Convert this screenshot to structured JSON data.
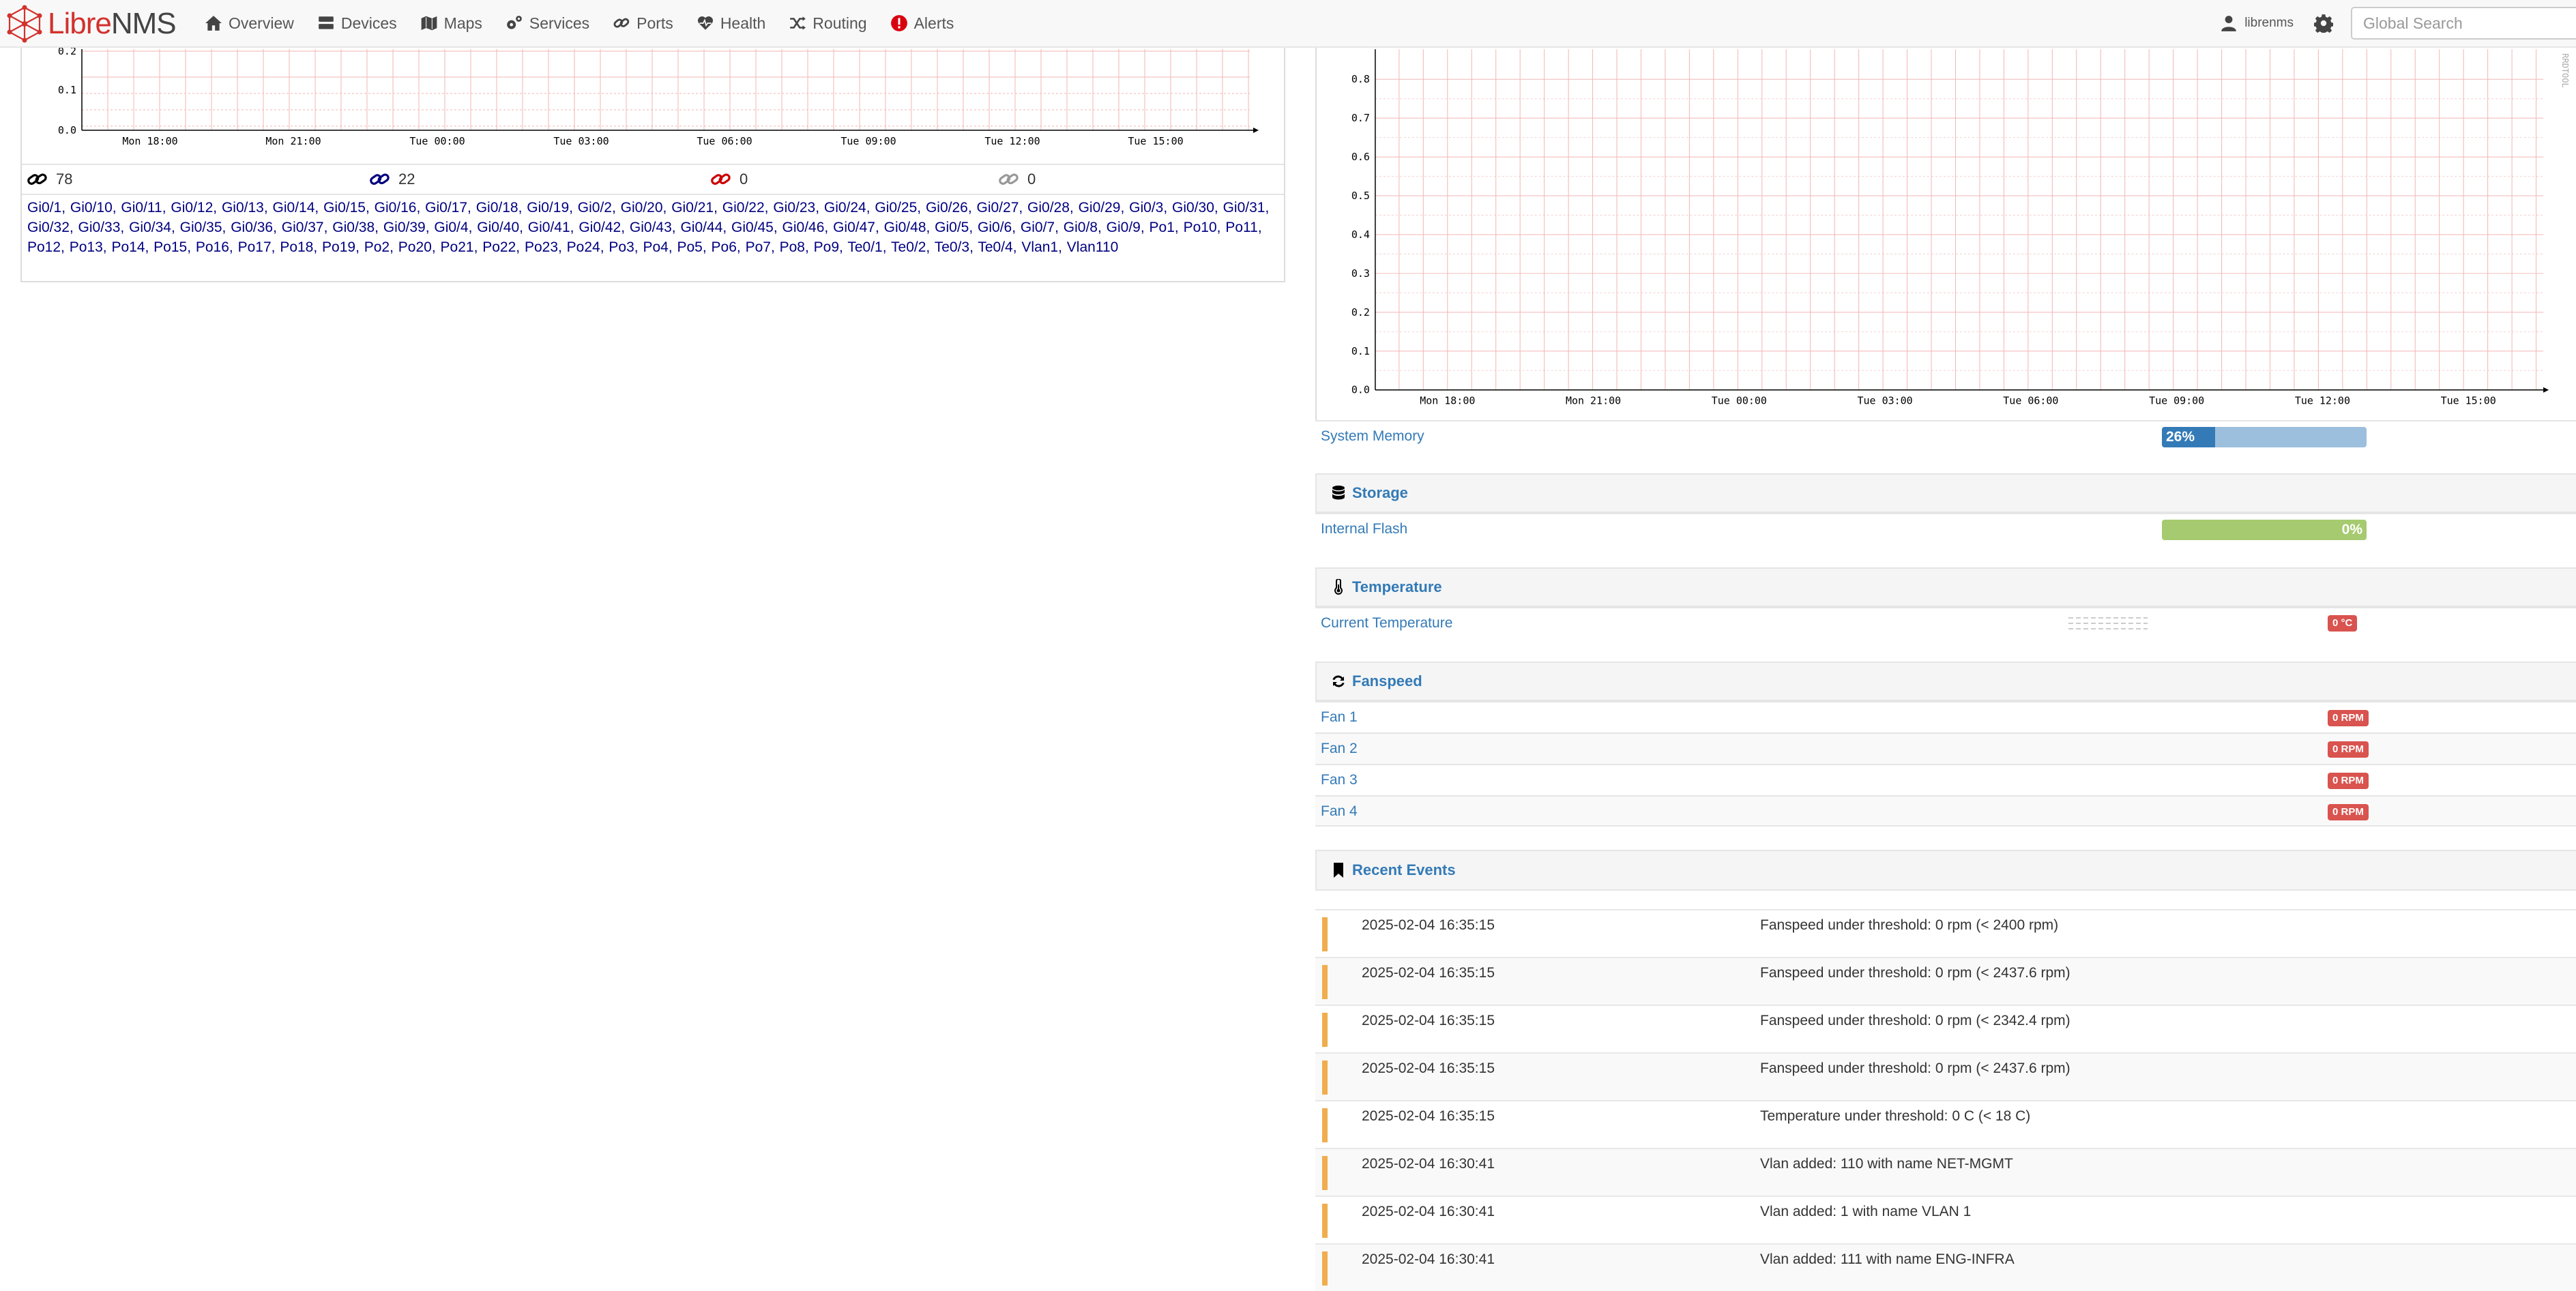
{
  "app": {
    "brand_libre": "Libre",
    "brand_nms": "NMS"
  },
  "navbar": {
    "items": [
      {
        "label": "Overview",
        "icon": "home-icon"
      },
      {
        "label": "Devices",
        "icon": "server-icon"
      },
      {
        "label": "Maps",
        "icon": "map-icon"
      },
      {
        "label": "Services",
        "icon": "cogs-icon"
      },
      {
        "label": "Ports",
        "icon": "link-icon"
      },
      {
        "label": "Health",
        "icon": "heartbeat-icon"
      },
      {
        "label": "Routing",
        "icon": "random-icon"
      },
      {
        "label": "Alerts",
        "icon": "alert-circle-icon"
      }
    ],
    "user": "librenms",
    "search_placeholder": "Global Search"
  },
  "ports_chart": {
    "y_ticks": [
      "0.2",
      "0.1",
      "0.0"
    ],
    "x_ticks": [
      "Mon 18:00",
      "Mon 21:00",
      "Tue 00:00",
      "Tue 03:00",
      "Tue 06:00",
      "Tue 09:00",
      "Tue 12:00",
      "Tue 15:00"
    ]
  },
  "port_stats": {
    "total": "78",
    "up": "22",
    "down": "0",
    "disabled": "0"
  },
  "ports_list": [
    "Gi0/1",
    "Gi0/10",
    "Gi0/11",
    "Gi0/12",
    "Gi0/13",
    "Gi0/14",
    "Gi0/15",
    "Gi0/16",
    "Gi0/17",
    "Gi0/18",
    "Gi0/19",
    "Gi0/2",
    "Gi0/20",
    "Gi0/21",
    "Gi0/22",
    "Gi0/23",
    "Gi0/24",
    "Gi0/25",
    "Gi0/26",
    "Gi0/27",
    "Gi0/28",
    "Gi0/29",
    "Gi0/3",
    "Gi0/30",
    "Gi0/31",
    "Gi0/32",
    "Gi0/33",
    "Gi0/34",
    "Gi0/35",
    "Gi0/36",
    "Gi0/37",
    "Gi0/38",
    "Gi0/39",
    "Gi0/4",
    "Gi0/40",
    "Gi0/41",
    "Gi0/42",
    "Gi0/43",
    "Gi0/44",
    "Gi0/45",
    "Gi0/46",
    "Gi0/47",
    "Gi0/48",
    "Gi0/5",
    "Gi0/6",
    "Gi0/7",
    "Gi0/8",
    "Gi0/9",
    "Po1",
    "Po10",
    "Po11",
    "Po12",
    "Po13",
    "Po14",
    "Po15",
    "Po16",
    "Po17",
    "Po18",
    "Po19",
    "Po2",
    "Po20",
    "Po21",
    "Po22",
    "Po23",
    "Po24",
    "Po3",
    "Po4",
    "Po5",
    "Po6",
    "Po7",
    "Po8",
    "Po9",
    "Te0/1",
    "Te0/2",
    "Te0/3",
    "Te0/4",
    "Vlan1",
    "Vlan110"
  ],
  "processor_chart": {
    "y_ticks": [
      "0.8",
      "0.7",
      "0.6",
      "0.5",
      "0.4",
      "0.3",
      "0.2",
      "0.1",
      "0.0"
    ],
    "x_ticks": [
      "Mon 18:00",
      "Mon 21:00",
      "Tue 00:00",
      "Tue 03:00",
      "Tue 06:00",
      "Tue 09:00",
      "Tue 12:00",
      "Tue 15:00"
    ],
    "side_note": "RRDTOOL"
  },
  "memory": {
    "label": "System Memory",
    "percent_text": "26%",
    "percent": 26,
    "bar_color": "#337ab7",
    "track_color": "#9dbfde"
  },
  "storage": {
    "title": "Storage",
    "label": "Internal Flash",
    "percent_text": "0%",
    "percent": 0,
    "bar_color": "#a6ca6f"
  },
  "temperature": {
    "title": "Temperature",
    "label": "Current Temperature",
    "value": "0 °C"
  },
  "fanspeed": {
    "title": "Fanspeed",
    "fans": [
      {
        "label": "Fan 1",
        "value": "0 RPM"
      },
      {
        "label": "Fan 2",
        "value": "0 RPM"
      },
      {
        "label": "Fan 3",
        "value": "0 RPM"
      },
      {
        "label": "Fan 4",
        "value": "0 RPM"
      }
    ]
  },
  "events": {
    "title": "Recent Events",
    "rows": [
      {
        "time": "2025-02-04 16:35:15",
        "message": "Fanspeed under threshold: 0 rpm (< 2400 rpm)"
      },
      {
        "time": "2025-02-04 16:35:15",
        "message": "Fanspeed under threshold: 0 rpm (< 2437.6 rpm)"
      },
      {
        "time": "2025-02-04 16:35:15",
        "message": "Fanspeed under threshold: 0 rpm (< 2342.4 rpm)"
      },
      {
        "time": "2025-02-04 16:35:15",
        "message": "Fanspeed under threshold: 0 rpm (< 2437.6 rpm)"
      },
      {
        "time": "2025-02-04 16:35:15",
        "message": "Temperature under threshold: 0 C (< 18 C)"
      },
      {
        "time": "2025-02-04 16:30:41",
        "message": "Vlan added: 110 with name NET-MGMT"
      },
      {
        "time": "2025-02-04 16:30:41",
        "message": "Vlan added: 1 with name VLAN 1"
      },
      {
        "time": "2025-02-04 16:30:41",
        "message": "Vlan added: 111 with name ENG-INFRA"
      }
    ],
    "severity_color": "#f0ad4e"
  }
}
